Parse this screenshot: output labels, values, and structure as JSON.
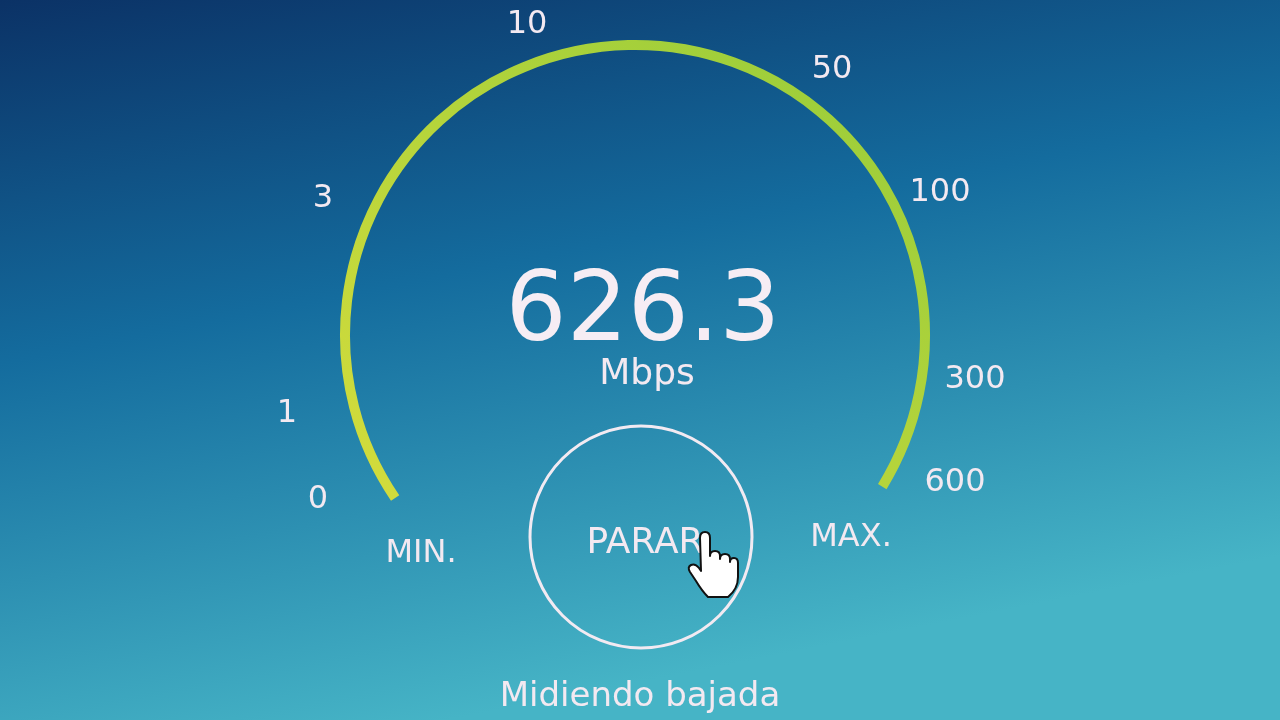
{
  "gauge": {
    "level": 1,
    "scale": [
      "0",
      "1",
      "3",
      "10",
      "50",
      "100",
      "300",
      "600"
    ],
    "min_label": "MIN.",
    "max_label": "MAX.",
    "reading": "626.3",
    "unit": "Mbps"
  },
  "stop_button": {
    "label": "PARAR"
  },
  "status": "Midiendo bajada"
}
